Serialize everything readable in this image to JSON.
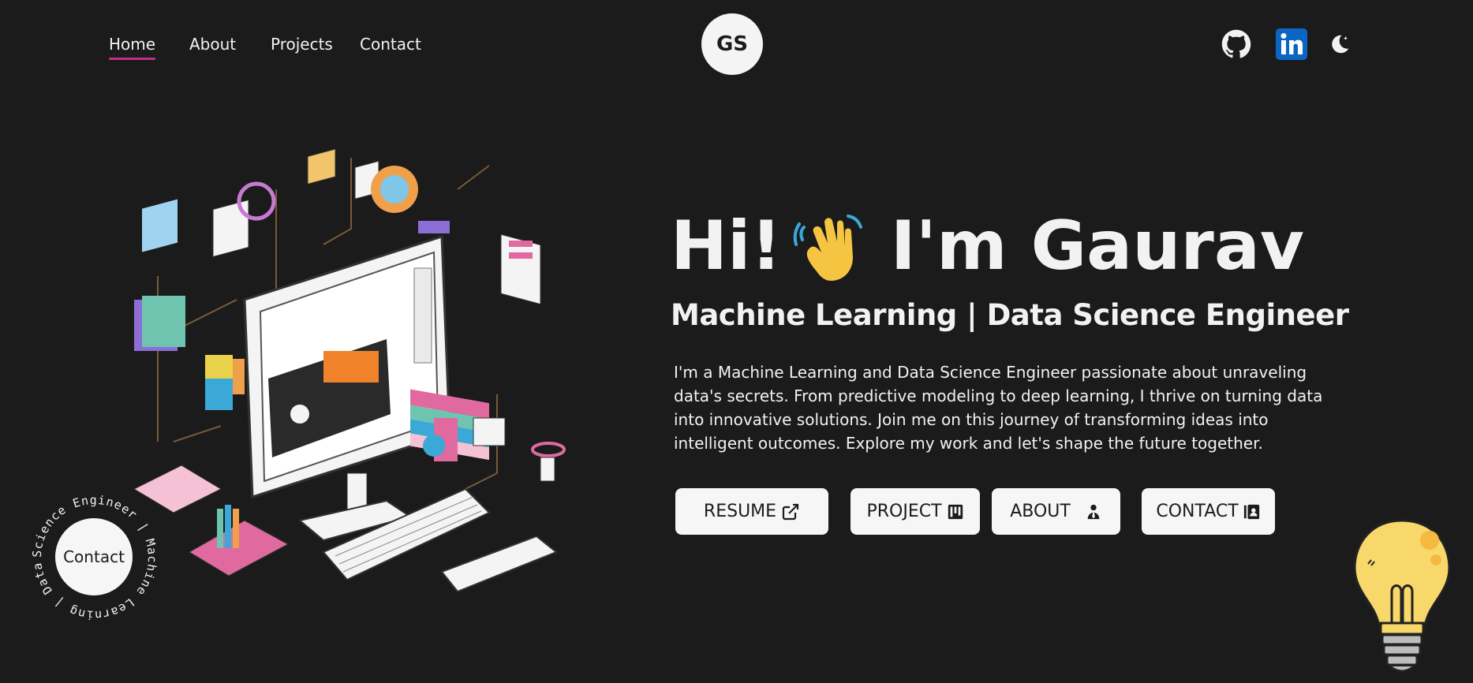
{
  "nav": {
    "links": [
      {
        "label": "Home",
        "active": true
      },
      {
        "label": "About",
        "active": false
      },
      {
        "label": "Projects",
        "active": false
      },
      {
        "label": "Contact",
        "active": false
      }
    ],
    "logo": "GS",
    "icons": [
      "github-icon",
      "linkedin-icon",
      "theme-toggle-moon-icon"
    ]
  },
  "hero": {
    "greeting": "Hi!",
    "name": "I'm Gaurav",
    "subtitle": "Machine Learning | Data Science Engineer",
    "description": "I'm a Machine Learning and Data Science Engineer passionate about unraveling data's secrets. From predictive modeling to deep learning, I thrive on turning data into innovative solutions. Join me on this journey of transforming ideas into intelligent outcomes. Explore my work and let's shape the future together."
  },
  "buttons": {
    "resume": "RESUME",
    "project": "PROJECT",
    "about": "ABOUT",
    "contact": "CONTACT"
  },
  "circle_contact": {
    "label": "Contact",
    "ring_text": "Science Engineer | Machine Learning | Data "
  },
  "colors": {
    "background": "#1b1b1b",
    "accent_underline": "#c2308a",
    "linkedin": "#0a66c2",
    "wave_emoji": "#f5c542"
  }
}
